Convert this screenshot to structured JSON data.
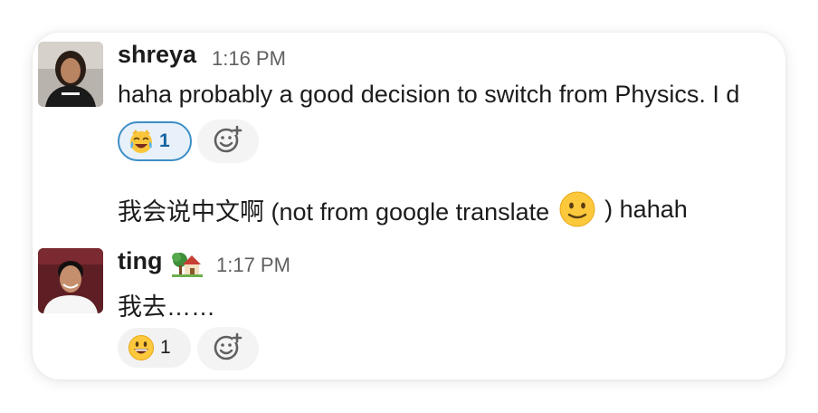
{
  "messages": [
    {
      "author": "shreya",
      "time": "1:16 PM",
      "text": "haha probably a good decision to switch from Physics. I d",
      "reactions": [
        {
          "emoji": "joy-cat-face",
          "count": "1",
          "active": true
        }
      ],
      "followup_text_before": "我会说中文啊 (not from google translate ",
      "followup_emoji": "slightly-smiling-face",
      "followup_text_after": " ) hahah"
    },
    {
      "author": "ting",
      "status_emoji": "house-with-garden",
      "time": "1:17 PM",
      "text": "我去……",
      "reactions": [
        {
          "emoji": "smiley-face",
          "count": "1",
          "active": false
        }
      ]
    }
  ],
  "colors": {
    "text": "#1d1c1d",
    "timestamp": "#616061",
    "reaction_active_border": "#3c8ec6",
    "reaction_active_bg": "#e8f1fa",
    "reaction_bg": "#f2f2f2"
  }
}
